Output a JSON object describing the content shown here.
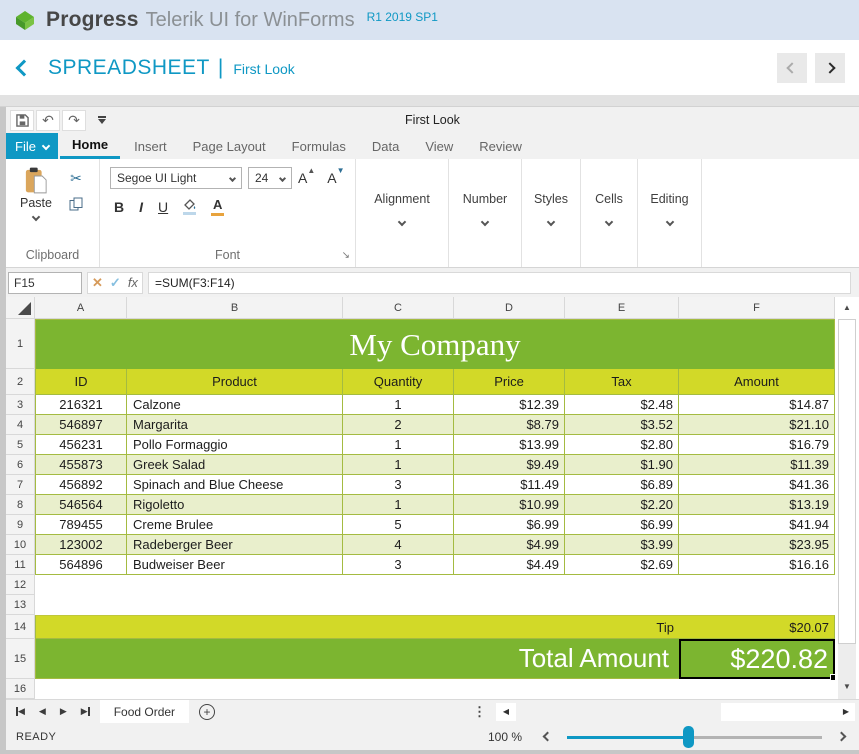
{
  "colors": {
    "accent": "#0f98c4",
    "banner_green": "#7cb530",
    "header_yellow": "#d2d928",
    "row_alt_green": "#e9efcc",
    "table_border": "#a4bb41"
  },
  "header": {
    "brand": "Progress",
    "product": "Telerik UI for WinForms",
    "version": "R1 2019 SP1"
  },
  "nav": {
    "title": "SPREADSHEET",
    "separator": "|",
    "subtitle": "First Look"
  },
  "ribbon": {
    "window_title": "First Look",
    "file_tab": "File",
    "tabs": [
      {
        "label": "Home"
      },
      {
        "label": "Insert"
      },
      {
        "label": "Page Layout"
      },
      {
        "label": "Formulas"
      },
      {
        "label": "Data"
      },
      {
        "label": "View"
      },
      {
        "label": "Review"
      }
    ],
    "clipboard": {
      "label": "Clipboard",
      "paste_label": "Paste"
    },
    "font": {
      "label": "Font",
      "name_value": "Segoe UI Light",
      "size_value": "24",
      "bold": "B",
      "italic": "I",
      "underline": "U",
      "grow": "A",
      "shrink": "A",
      "color_letter": "A"
    },
    "collapsed_groups": [
      {
        "label": "Alignment"
      },
      {
        "label": "Number"
      },
      {
        "label": "Styles"
      },
      {
        "label": "Cells"
      },
      {
        "label": "Editing"
      }
    ]
  },
  "formula_bar": {
    "name_box": "F15",
    "cancel_glyph": "✕",
    "confirm_glyph": "✓",
    "fx_label": "fx",
    "formula": "=SUM(F3:F14)"
  },
  "sheet": {
    "columns": [
      "A",
      "B",
      "C",
      "D",
      "E",
      "F"
    ],
    "row_numbers": [
      "1",
      "2",
      "3",
      "4",
      "5",
      "6",
      "7",
      "8",
      "9",
      "10",
      "11",
      "12",
      "13",
      "14",
      "15",
      "16"
    ],
    "title": "My Company",
    "headers": [
      "ID",
      "Product",
      "Quantity",
      "Price",
      "Tax",
      "Amount"
    ],
    "rows": [
      {
        "cells": [
          "216321",
          "Calzone",
          "1",
          "$12.39",
          "$2.48",
          "$14.87"
        ]
      },
      {
        "cells": [
          "546897",
          "Margarita",
          "2",
          "$8.79",
          "$3.52",
          "$21.10"
        ]
      },
      {
        "cells": [
          "456231",
          "Pollo Formaggio",
          "1",
          "$13.99",
          "$2.80",
          "$16.79"
        ]
      },
      {
        "cells": [
          "455873",
          "Greek Salad",
          "1",
          "$9.49",
          "$1.90",
          "$11.39"
        ]
      },
      {
        "cells": [
          "456892",
          "Spinach and Blue Cheese",
          "3",
          "$11.49",
          "$6.89",
          "$41.36"
        ]
      },
      {
        "cells": [
          "546564",
          "Rigoletto",
          "1",
          "$10.99",
          "$2.20",
          "$13.19"
        ]
      },
      {
        "cells": [
          "789455",
          "Creme Brulee",
          "5",
          "$6.99",
          "$6.99",
          "$41.94"
        ]
      },
      {
        "cells": [
          "123002",
          "Radeberger Beer",
          "4",
          "$4.99",
          "$3.99",
          "$23.95"
        ]
      },
      {
        "cells": [
          "564896",
          "Budweiser Beer",
          "3",
          "$4.49",
          "$2.69",
          "$16.16"
        ]
      }
    ],
    "tip_label": "Tip",
    "tip_value": "$20.07",
    "total_label": "Total Amount",
    "total_value": "$220.82",
    "selected_cell": "F15"
  },
  "sheet_bar": {
    "tab_label": "Food Order",
    "first_glyph": "◀",
    "prev_glyph": "◀",
    "next_glyph": "▶",
    "last_glyph": "▶",
    "add_glyph": "+",
    "grip_glyph": "⋮",
    "scroll_left_glyph": "◀",
    "scroll_right_glyph": "▶"
  },
  "status_bar": {
    "ready": "READY",
    "zoom_level": "100 %"
  },
  "icons": {
    "undo": "↶",
    "redo": "↷",
    "cut": "✂",
    "up_arrow": "▲",
    "down_arrow": "▼",
    "launcher": "↘"
  }
}
